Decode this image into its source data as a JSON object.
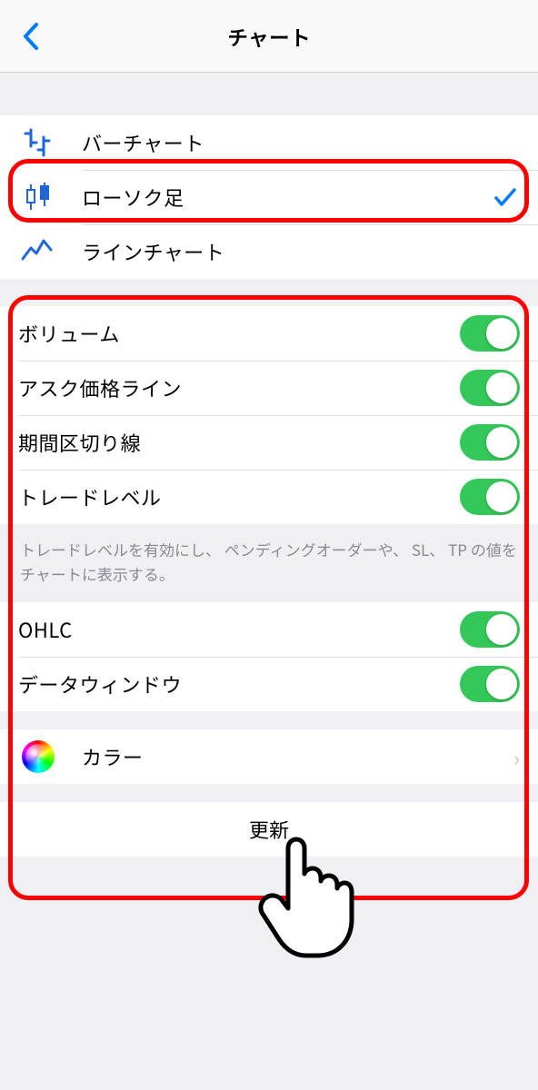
{
  "navbar": {
    "title": "チャート"
  },
  "chart_types": {
    "items": [
      {
        "label": "バーチャート",
        "selected": false,
        "icon": "bar"
      },
      {
        "label": "ローソク足",
        "selected": true,
        "icon": "candle"
      },
      {
        "label": "ラインチャート",
        "selected": false,
        "icon": "line"
      }
    ]
  },
  "toggles1": {
    "items": [
      {
        "label": "ボリューム",
        "on": true
      },
      {
        "label": "アスク価格ライン",
        "on": true
      },
      {
        "label": "期間区切り線",
        "on": true
      },
      {
        "label": "トレードレベル",
        "on": true
      }
    ],
    "footer": "トレードレベルを有効にし、 ペンディングオーダーや、 SL、 TP の値をチャートに表示する。"
  },
  "toggles2": {
    "items": [
      {
        "label": "OHLC",
        "on": true
      },
      {
        "label": "データウィンドウ",
        "on": true
      }
    ]
  },
  "color_row": {
    "label": "カラー"
  },
  "update": {
    "label": "更新"
  }
}
